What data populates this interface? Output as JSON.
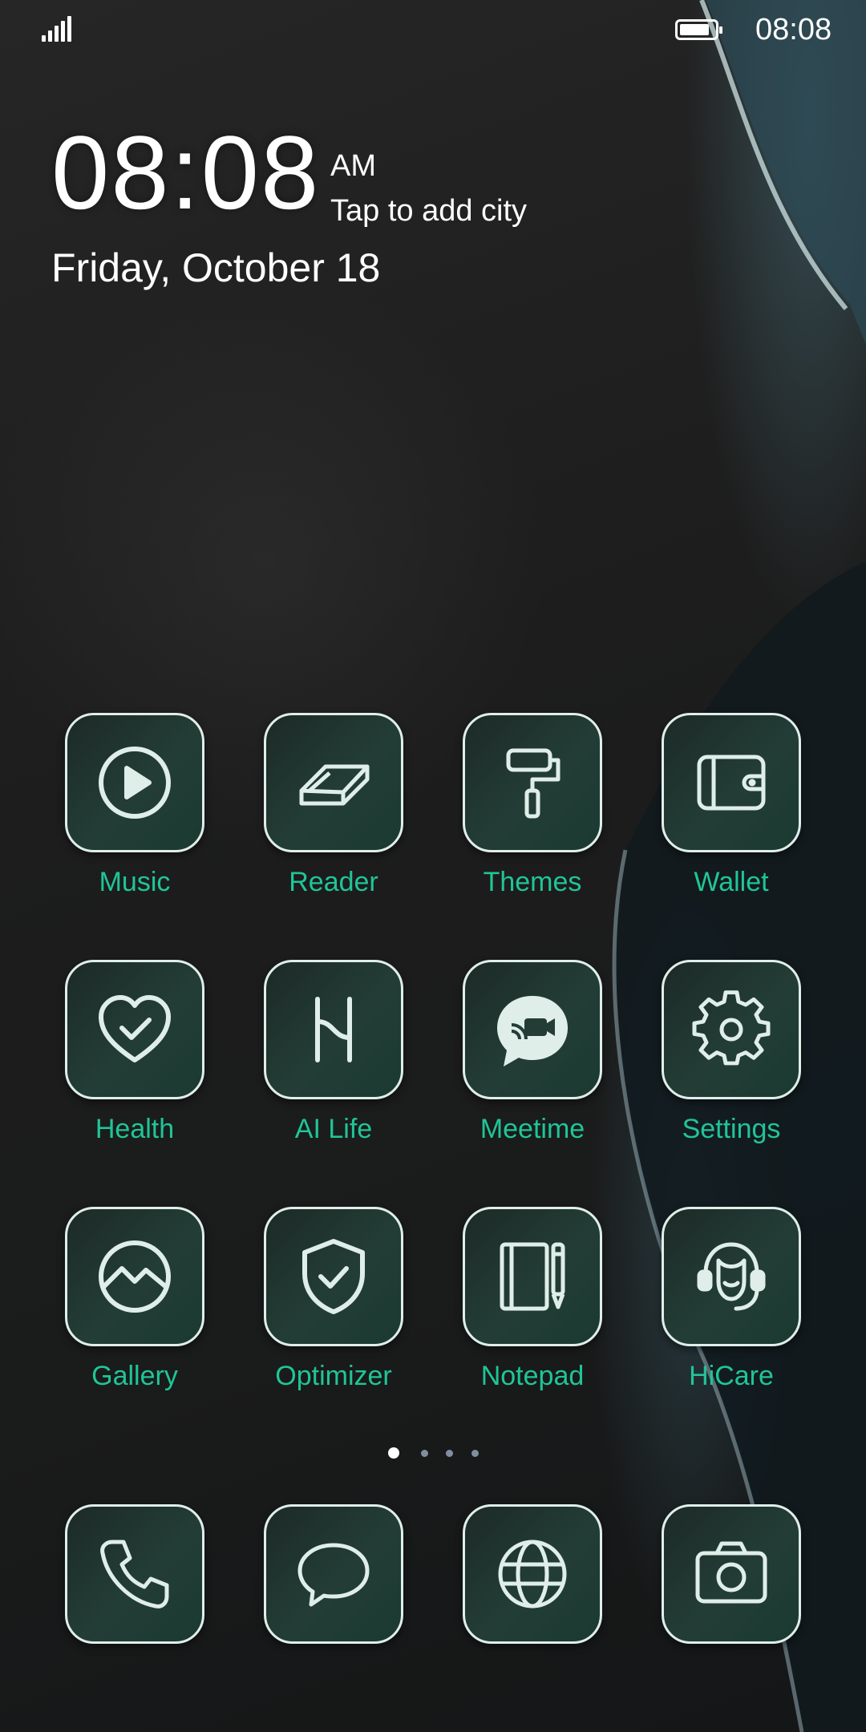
{
  "status_bar": {
    "time": "08:08",
    "signal_icon": "signal-icon",
    "battery_icon": "battery-icon",
    "battery_level": 0.85
  },
  "clock_widget": {
    "time": "08:08",
    "ampm": "AM",
    "city_prompt": "Tap to add city",
    "date": "Friday, October 18"
  },
  "apps": [
    {
      "label": "Music",
      "icon": "play-circle-icon"
    },
    {
      "label": "Reader",
      "icon": "book-icon"
    },
    {
      "label": "Themes",
      "icon": "paint-roller-icon"
    },
    {
      "label": "Wallet",
      "icon": "wallet-icon"
    },
    {
      "label": "Health",
      "icon": "heart-check-icon"
    },
    {
      "label": "AI Life",
      "icon": "ai-life-icon"
    },
    {
      "label": "Meetime",
      "icon": "video-chat-icon"
    },
    {
      "label": "Settings",
      "icon": "gear-icon"
    },
    {
      "label": "Gallery",
      "icon": "gallery-icon"
    },
    {
      "label": "Optimizer",
      "icon": "shield-check-icon"
    },
    {
      "label": "Notepad",
      "icon": "notepad-icon"
    },
    {
      "label": "HiCare",
      "icon": "headset-icon"
    }
  ],
  "page_indicator": {
    "pages": 4,
    "active": 1
  },
  "dock": [
    {
      "icon": "phone-icon"
    },
    {
      "icon": "message-icon"
    },
    {
      "icon": "globe-icon"
    },
    {
      "icon": "camera-icon"
    }
  ],
  "colors": {
    "label_color": "#20c597",
    "icon_stroke": "#dfeee8",
    "tile_bg": "#233d36"
  }
}
